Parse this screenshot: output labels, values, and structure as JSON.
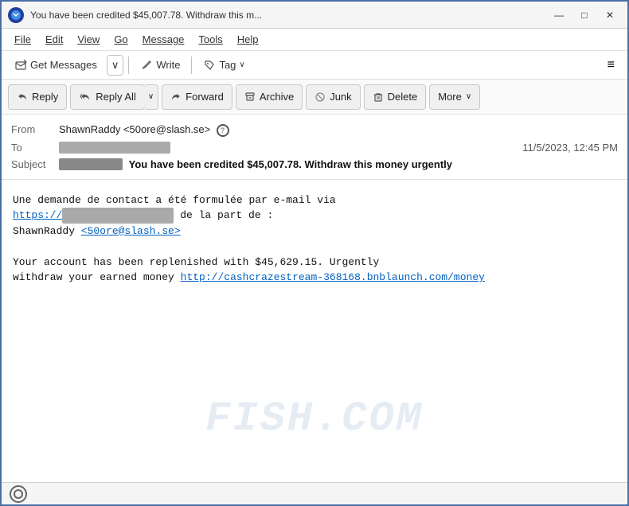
{
  "window": {
    "title": "You have been credited $45,007.78. Withdraw this m...",
    "icon_label": "thunderbird-icon"
  },
  "window_controls": {
    "minimize": "—",
    "maximize": "□",
    "close": "✕"
  },
  "menu": {
    "items": [
      "File",
      "Edit",
      "View",
      "Go",
      "Message",
      "Tools",
      "Help"
    ]
  },
  "toolbar1": {
    "get_messages_label": "Get Messages",
    "dropdown_arrow": "∨",
    "write_label": "Write",
    "tag_label": "Tag",
    "tag_arrow": "∨",
    "hamburger": "≡"
  },
  "toolbar2": {
    "reply_label": "Reply",
    "reply_all_label": "Reply All",
    "dropdown_arrow": "∨",
    "forward_label": "Forward",
    "archive_label": "Archive",
    "junk_label": "Junk",
    "delete_label": "Delete",
    "more_label": "More",
    "more_arrow": "∨"
  },
  "email": {
    "from_label": "From",
    "from_value": "ShawnRaddy <50ore@slash.se>",
    "to_label": "To",
    "to_redacted": "████████████████",
    "date": "11/5/2023, 12:45 PM",
    "subject_label": "Subject",
    "subject_redacted": "████████",
    "subject_text": "You have been credited $45,007.78. Withdraw this money urgently",
    "body_line1": "Une demande de contact a été formulée par e-mail via",
    "body_link1_prefix": "https://",
    "body_link1_redacted": "████████████",
    "body_line2": " de la part de :",
    "body_line3": "ShawnRaddy",
    "body_link2": "<50ore@slash.se>",
    "body_line4": "",
    "body_line5": "Your account has been replenished with $45,629.15. Urgently",
    "body_line6": "withdraw your earned money",
    "body_link3": "http://cashcrazestream-368168.bnblaunch.com/money",
    "watermark": "FISH.COM"
  },
  "status_bar": {
    "icon_label": "signal-icon"
  }
}
